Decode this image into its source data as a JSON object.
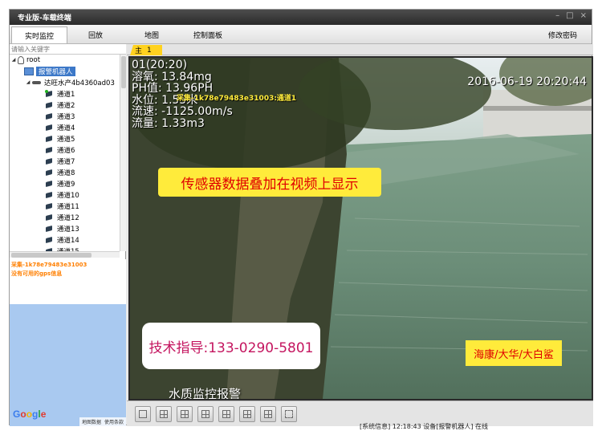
{
  "window": {
    "title": "专业版-车载终端"
  },
  "nav": {
    "tabs": [
      {
        "label": "实时监控",
        "active": true
      },
      {
        "label": "回放"
      },
      {
        "label": "地图"
      },
      {
        "label": "控制面板"
      }
    ],
    "change_password": "修改密码"
  },
  "sidebar": {
    "search_placeholder": "请输入关键字",
    "tree": [
      {
        "label": "root",
        "icon": "user-icon"
      },
      {
        "label": "报警机器人",
        "icon": "alarm-device-icon",
        "selected": true
      },
      {
        "label": "达旺水产4b4360ad03",
        "icon": "vehicle-icon"
      },
      {
        "label": "通道1",
        "icon": "camera-online-icon"
      },
      {
        "label": "通道2",
        "icon": "camera-icon"
      },
      {
        "label": "通道3",
        "icon": "camera-icon"
      },
      {
        "label": "通道4",
        "icon": "camera-icon"
      },
      {
        "label": "通道5",
        "icon": "camera-icon"
      },
      {
        "label": "通道6",
        "icon": "camera-icon"
      },
      {
        "label": "通道7",
        "icon": "camera-icon"
      },
      {
        "label": "通道8",
        "icon": "camera-icon"
      },
      {
        "label": "通道9",
        "icon": "camera-icon"
      },
      {
        "label": "通道10",
        "icon": "camera-icon"
      },
      {
        "label": "通道11",
        "icon": "camera-icon"
      },
      {
        "label": "通道12",
        "icon": "camera-icon"
      },
      {
        "label": "通道13",
        "icon": "camera-icon"
      },
      {
        "label": "通道14",
        "icon": "camera-icon"
      },
      {
        "label": "通道15",
        "icon": "camera-icon"
      }
    ],
    "info_line1": "采集-1k78e79483e31003",
    "info_line2": "没有可用的gps信息",
    "map": {
      "logo": [
        "G",
        "o",
        "o",
        "g",
        "l",
        "e"
      ],
      "link_data": "地图数据",
      "link_terms": "使用条款"
    }
  },
  "video": {
    "tab_label": "主",
    "tab_number": "1",
    "osd": {
      "channel_time": "01(20:20)",
      "dissolved_oxygen": "溶氧: 13.84mg",
      "ph": "PH值: 13.96PH",
      "water_level": "水位: 1.55米",
      "flow_speed": "流速: -1125.00m/s",
      "flow_volume": "流量: 1.33m3",
      "timestamp": "2016-06-19 20:20:44",
      "device_label": "采集-1k78e79483e31003:通道1"
    },
    "caption": "传感器数据叠加在视频上显示",
    "support": "技术指导:133-0290-5801",
    "brands": "海康/大华/大白鲨",
    "watermark": "水质监控报警"
  },
  "toolbar": {
    "buttons": [
      "layout-1-icon",
      "layout-4-icon",
      "layout-9-icon",
      "layout-16-icon",
      "layout-25-icon",
      "layout-36-icon",
      "layout-64-icon",
      "fullscreen-icon"
    ],
    "status": "[系统信息] 12:18:43 设备[报警机器人] 在线"
  },
  "colors": {
    "title_bar": "#333333",
    "selection": "#3c78c8",
    "overlay_yellow": "#ffeb3b",
    "overlay_red": "#e00000",
    "info_orange": "#ff7f00",
    "map_blue": "#a9c9f0"
  }
}
